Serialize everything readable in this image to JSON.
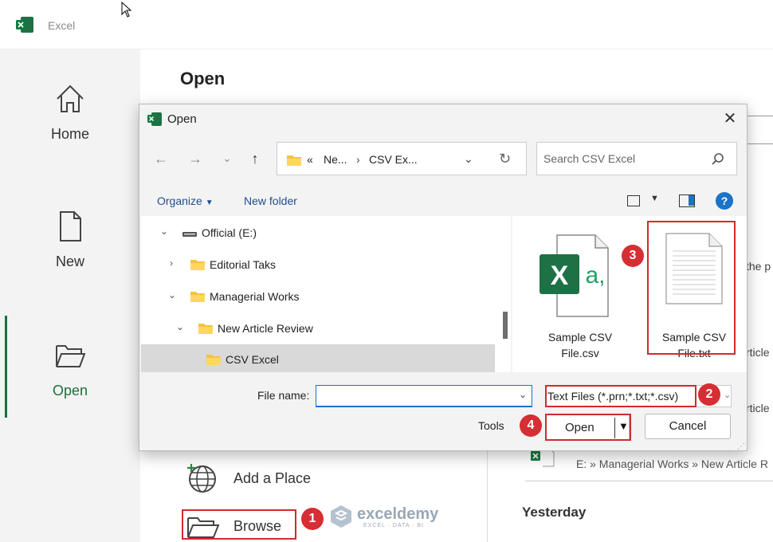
{
  "app": {
    "title": "Excel"
  },
  "leftnav": [
    {
      "label": "Home",
      "icon": "home-icon"
    },
    {
      "label": "New",
      "icon": "new-document-icon"
    },
    {
      "label": "Open",
      "icon": "open-folder-icon"
    }
  ],
  "page": {
    "title": "Open"
  },
  "places": {
    "add": "Add a Place",
    "browse": "Browse"
  },
  "recent": {
    "fragments": [
      "the p",
      "rticle R",
      "rticle R"
    ],
    "path": "E: » Managerial Works » New Article R",
    "yesterday": "Yesterday"
  },
  "watermark": {
    "name": "exceldemy",
    "tag": "EXCEL · DATA · BI"
  },
  "dialog": {
    "title": "Open",
    "address": [
      "Ne...",
      "CSV Ex..."
    ],
    "address_prefix": "«",
    "search_placeholder": "Search CSV Excel",
    "organize": "Organize",
    "new_folder": "New folder",
    "help": "?",
    "tree": [
      {
        "label": "Official (E:)",
        "arrow": "⌄",
        "type": "drive"
      },
      {
        "label": "Editorial Taks",
        "arrow": "›",
        "type": "folder"
      },
      {
        "label": "Managerial Works",
        "arrow": "⌄",
        "type": "folder"
      },
      {
        "label": "New Article Review",
        "arrow": "⌄",
        "type": "folder"
      },
      {
        "label": "CSV Excel",
        "arrow": "",
        "type": "folder"
      }
    ],
    "files": [
      {
        "line1": "Sample CSV",
        "line2": "File.csv"
      },
      {
        "line1": "Sample CSV",
        "line2": "File.txt"
      }
    ],
    "file_name_label": "File name:",
    "file_name_value": "",
    "filter": "Text Files (*.prn;*.txt;*.csv)",
    "tools": "Tools",
    "open": "Open",
    "cancel": "Cancel"
  },
  "badges": [
    "1",
    "2",
    "3",
    "4"
  ],
  "colors": {
    "accent": "#1e6f3b",
    "highlight": "#cf2b30",
    "link": "#1f4e8c"
  }
}
